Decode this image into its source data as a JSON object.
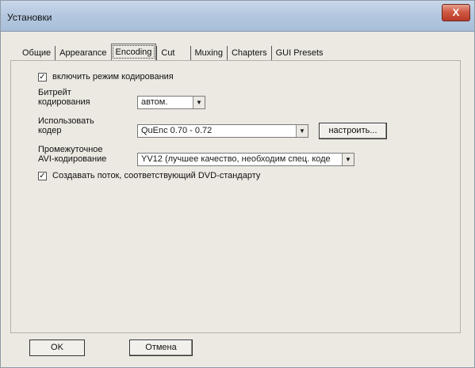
{
  "window": {
    "title": "Установки",
    "close_label": "X"
  },
  "tabs": [
    {
      "label": "Общие"
    },
    {
      "label": "Appearance"
    },
    {
      "label": "Encoding"
    },
    {
      "label": "Cut"
    },
    {
      "label": "Muxing"
    },
    {
      "label": "Chapters"
    },
    {
      "label": "GUI Presets"
    }
  ],
  "encoding": {
    "enable_encoding": {
      "label": "включить режим кодирования",
      "checked": true
    },
    "bitrate": {
      "label_line1": "Битрейт",
      "label_line2": "кодирования",
      "value": "автом."
    },
    "encoder": {
      "label_line1": "Использовать",
      "label_line2": "кодер",
      "value": "QuEnc 0.70 - 0.72",
      "configure_label": "настроить..."
    },
    "avi": {
      "label_line1": "Промежуточное",
      "label_line2": "AVI-кодирование",
      "value": "YV12 (лучшее качество, необходим спец. коде"
    },
    "dvd_stream": {
      "label": "Создавать поток, соответствующий DVD-стандарту",
      "checked": true
    }
  },
  "buttons": {
    "ok_label": "OK",
    "cancel_label": "Отмена"
  }
}
